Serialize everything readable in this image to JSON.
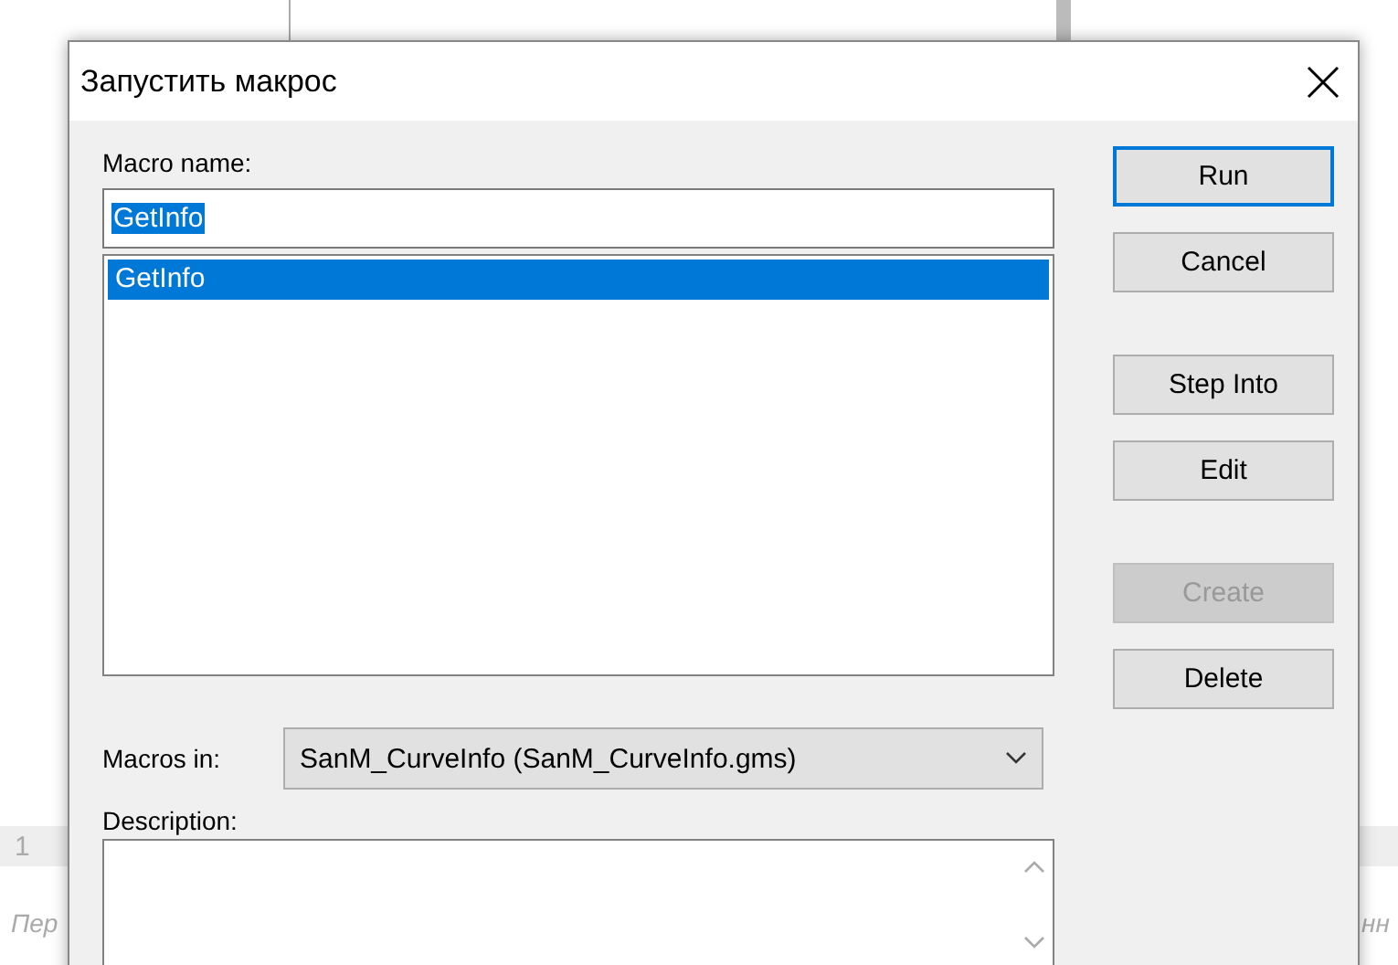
{
  "background": {
    "row_number": "1",
    "left_text": "Пер",
    "right_text": "нн"
  },
  "window": {
    "title": "Запустить макрос"
  },
  "macro_name": {
    "label": "Macro name:",
    "value": "GetInfo"
  },
  "macro_list": [
    {
      "label": "GetInfo",
      "selected": true
    }
  ],
  "button_groups": [
    [
      {
        "label": "Run",
        "default": true,
        "disabled": false
      },
      {
        "label": "Cancel",
        "default": false,
        "disabled": false
      }
    ],
    [
      {
        "label": "Step Into",
        "default": false,
        "disabled": false
      },
      {
        "label": "Edit",
        "default": false,
        "disabled": false
      }
    ],
    [
      {
        "label": "Create",
        "default": false,
        "disabled": true
      },
      {
        "label": "Delete",
        "default": false,
        "disabled": false
      }
    ]
  ],
  "macros_in": {
    "label": "Macros in:",
    "value": "SanM_CurveInfo (SanM_CurveInfo.gms)"
  },
  "description": {
    "label": "Description:"
  }
}
